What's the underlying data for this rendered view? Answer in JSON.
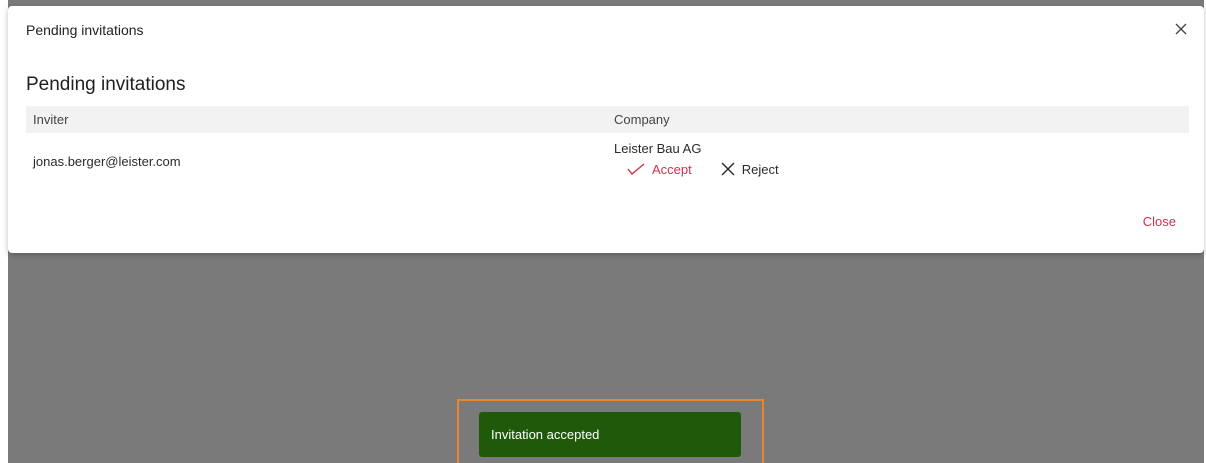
{
  "dialog": {
    "title": "Pending invitations",
    "heading": "Pending invitations",
    "close_label": "Close"
  },
  "table": {
    "headers": {
      "inviter": "Inviter",
      "company": "Company"
    },
    "rows": [
      {
        "inviter": "jonas.berger@leister.com",
        "company": "Leister Bau AG",
        "accept_label": "Accept",
        "reject_label": "Reject"
      }
    ]
  },
  "toast": {
    "message": "Invitation accepted"
  },
  "colors": {
    "accent": "#d4314b",
    "toast_bg": "#1f5a0b",
    "backdrop": "#7a7a7a",
    "highlight": "#e8862c"
  },
  "icons": {
    "close": "close-icon",
    "accept": "check-icon",
    "reject": "x-icon"
  }
}
